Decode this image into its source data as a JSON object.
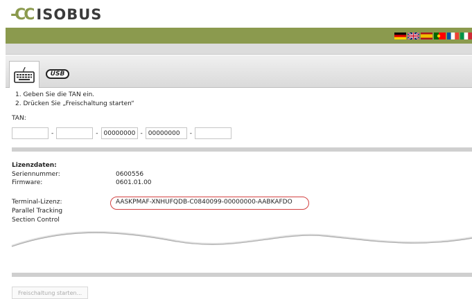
{
  "header": {
    "logo_mark": "-CC",
    "logo_text": "ISOBUS",
    "flags": [
      "german-flag",
      "british-flag",
      "spanish-flag",
      "portuguese-flag",
      "french-flag",
      "italian-flag"
    ]
  },
  "tabs": [
    {
      "name": "keyboard",
      "active": true
    },
    {
      "name": "usb",
      "label": "USB",
      "active": false
    }
  ],
  "instructions": [
    "1. Geben Sie die TAN ein.",
    "2. Drücken Sie „Freischaltung starten“"
  ],
  "tan": {
    "label": "TAN:",
    "separator": "-",
    "fields": [
      "",
      "",
      "00000000",
      "00000000",
      ""
    ]
  },
  "license": {
    "title": "Lizenzdaten:",
    "serial_label": "Seriennummer:",
    "serial_value": "0600556",
    "firmware_label": "Firmware:",
    "firmware_value": "0601.01.00",
    "terminal_label": "Terminal-Lizenz:",
    "terminal_value": "AASKPMAF-XNHUFQDB-C0840099-00000000-AABKAFDO",
    "feature_1": "Parallel Tracking",
    "feature_2": "Section Control"
  },
  "actions": {
    "start_label": "Freischaltung starten..."
  },
  "colors": {
    "topbar": "#8b9a4e",
    "highlight": "#d24040"
  }
}
